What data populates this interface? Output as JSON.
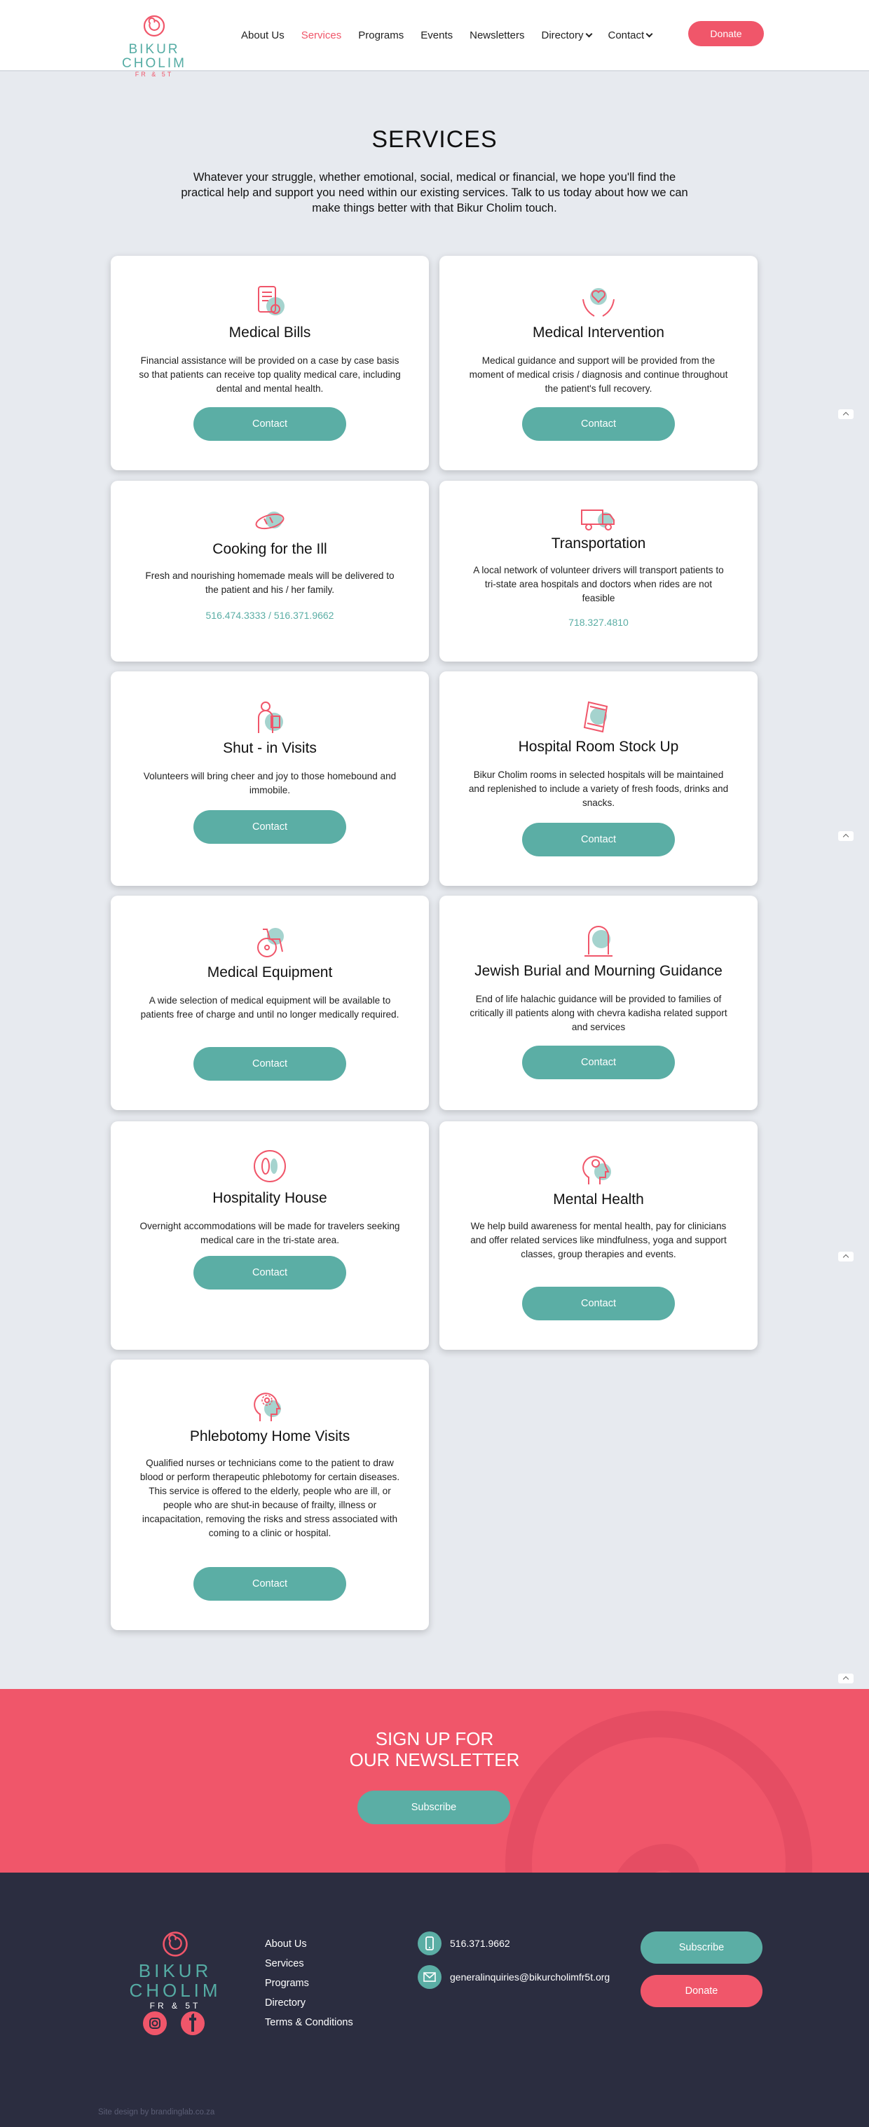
{
  "brand": {
    "name": "BIKUR CHOLIM",
    "sub": "FR & 5T"
  },
  "nav": {
    "items": [
      {
        "label": "About Us"
      },
      {
        "label": "Services"
      },
      {
        "label": "Programs"
      },
      {
        "label": "Events"
      },
      {
        "label": "Newsletters"
      },
      {
        "label": "Directory"
      },
      {
        "label": "Contact"
      }
    ],
    "donate": "Donate"
  },
  "page": {
    "title": "SERVICES",
    "intro": "Whatever your struggle, whether emotional, social, medical or financial, we hope you'll find the practical help and support you need within our existing services. Talk to us today about how we can make things better with that Bikur Cholim touch."
  },
  "services": [
    {
      "title": "Medical Bills",
      "desc": "Financial assistance will be provided on a case by case basis so that patients can receive top quality medical care, including dental and mental health.",
      "button": "Contact",
      "icon": "bill-icon"
    },
    {
      "title": "Medical Intervention",
      "desc": "Medical guidance and support will be provided from the moment of medical crisis / diagnosis and continue throughout the patient's full recovery.",
      "button": "Contact",
      "icon": "heart-hands-icon"
    },
    {
      "title": "Cooking for the Ill",
      "desc": "Fresh and nourishing homemade meals will be delivered to the patient and his / her family.",
      "phone": "516.474.3333 / 516.371.9662",
      "icon": "bread-icon"
    },
    {
      "title": "Transportation",
      "desc": "A local network of volunteer drivers will transport patients to tri-state area hospitals and doctors when rides are not feasible",
      "phone": "718.327.4810",
      "icon": "truck-icon"
    },
    {
      "title": "Shut - in Visits",
      "desc": "Volunteers will bring cheer and joy to those homebound and immobile.",
      "button": "Contact",
      "icon": "visitor-icon"
    },
    {
      "title": "Hospital Room Stock Up",
      "desc": "Bikur Cholim rooms in selected hospitals will be maintained and replenished to include a variety of fresh foods, drinks and snacks.",
      "button": "Contact",
      "icon": "snack-bag-icon"
    },
    {
      "title": "Medical Equipment",
      "desc": "A wide selection of medical equipment will be available to patients free of charge and until no longer medically required.",
      "button": "Contact",
      "icon": "wheelchair-icon"
    },
    {
      "title": "Jewish Burial and Mourning Guidance",
      "desc": "End of life halachic guidance will be provided to families of critically ill patients along with chevra kadisha related support and services",
      "button": "Contact",
      "icon": "tombstone-icon"
    },
    {
      "title": "Hospitality House",
      "desc": "Overnight accommodations will be made for travelers seeking medical care in the tri-state area.",
      "button": "Contact",
      "icon": "footprints-icon"
    },
    {
      "title": "Mental Health",
      "desc": "We help build awareness for mental health, pay for clinicians and offer related services like mindfulness, yoga  and support classes, group therapies and events.",
      "button": "Contact",
      "icon": "mind-icon"
    },
    {
      "title": "Phlebotomy Home Visits",
      "desc": "Qualified nurses or technicians come to the patient to draw blood or perform therapeutic phlebotomy for certain diseases. This service is offered to the elderly, people who are ill, or people who are shut-in because of frailty, illness or incapacitation, removing the risks and stress associated with coming to a clinic or hospital.",
      "button": "Contact",
      "icon": "head-flower-icon"
    }
  ],
  "newsletter": {
    "title_line1": "SIGN UP FOR",
    "title_line2": "OUR NEWSLETTER",
    "button": "Subscribe"
  },
  "footer": {
    "links": [
      "About Us",
      "Services",
      "Programs",
      "Directory",
      "Terms & Conditions"
    ],
    "phone": "516.371.9662",
    "email": "generalinquiries@bikurcholimfr5t.org",
    "subscribe": "Subscribe",
    "donate": "Donate",
    "credit": "Site design by brandinglab.co.za"
  },
  "colors": {
    "accent": "#f0566a",
    "teal": "#5baea5",
    "footer_bg": "#2b2d40",
    "page_bg": "#e7eaef"
  }
}
